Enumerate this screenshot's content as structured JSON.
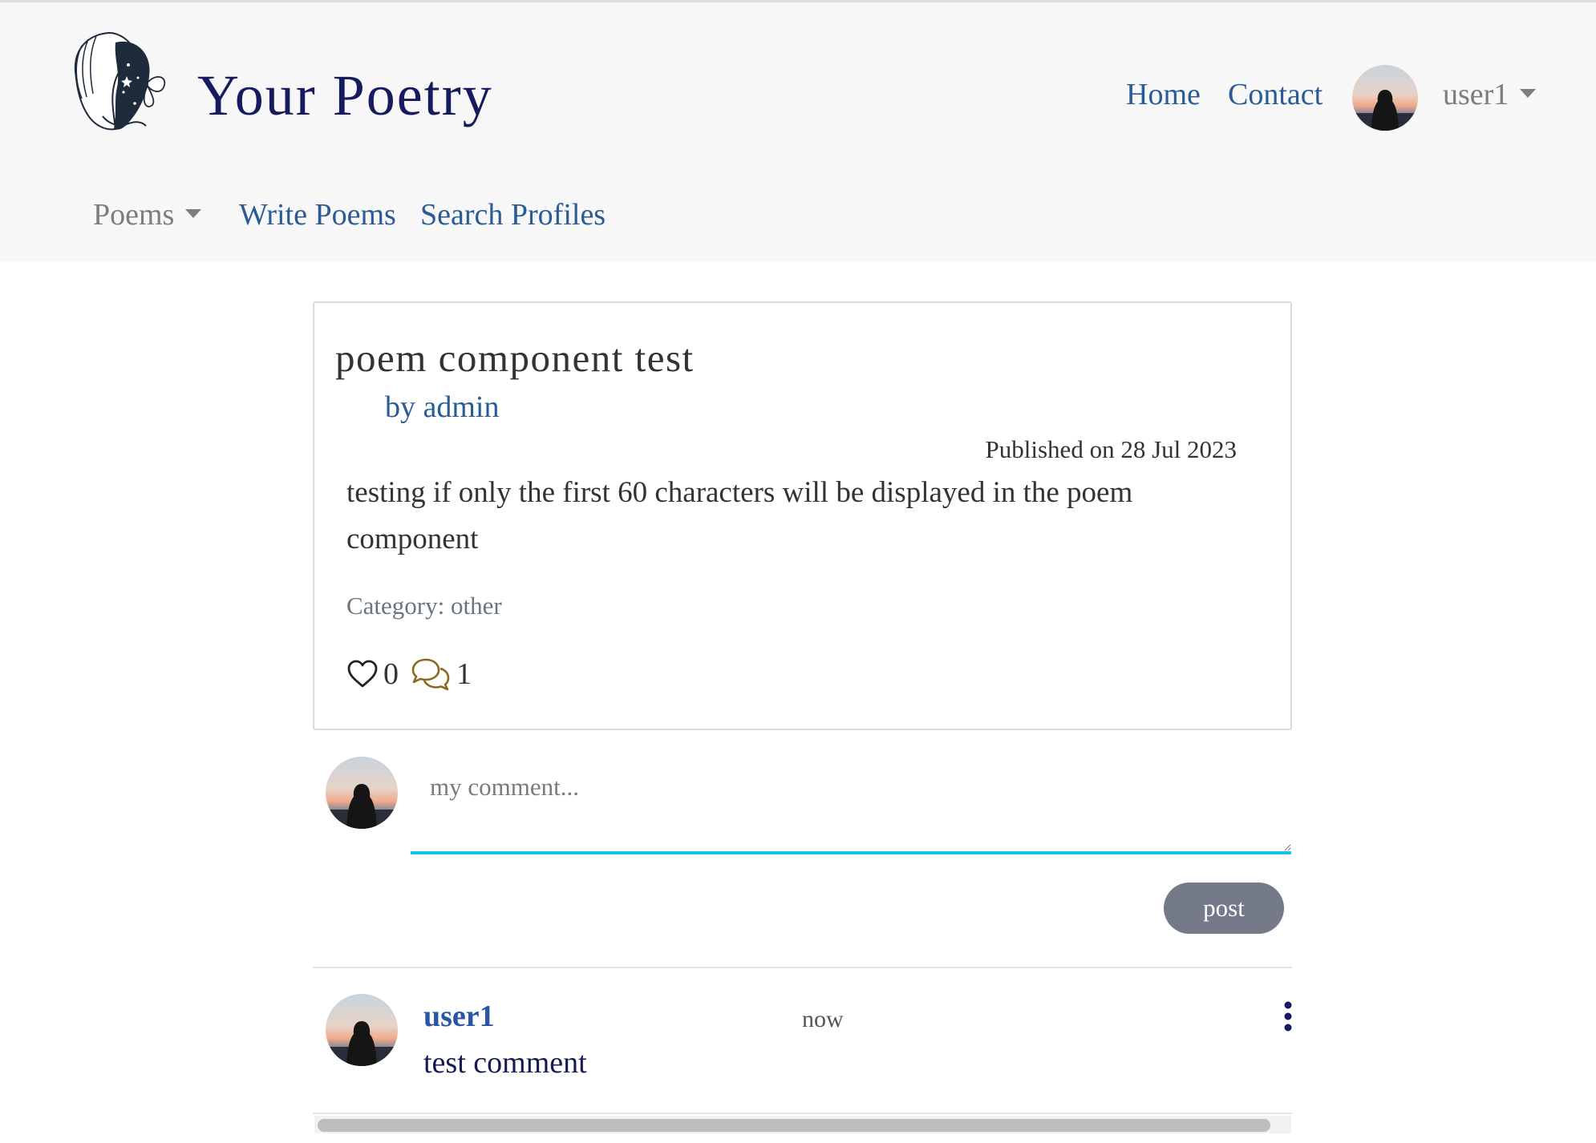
{
  "header": {
    "brand": "Your Poetry",
    "nav": {
      "home": "Home",
      "contact": "Contact"
    },
    "user_menu_label": "user1",
    "secondary_nav": {
      "poems": "Poems",
      "write_poems": "Write Poems",
      "search_profiles": "Search Profiles"
    }
  },
  "poem": {
    "title": "poem component test",
    "author": "by admin",
    "published": "Published on 28 Jul 2023",
    "body": "testing if only the first 60 characters will be displayed in the poem component",
    "category": "Category: other",
    "likes": "0",
    "comments": "1"
  },
  "comment_form": {
    "placeholder": "my comment...",
    "submit_label": "post"
  },
  "comments": [
    {
      "user": "user1",
      "time": "now",
      "text": "test comment"
    }
  ],
  "colors": {
    "brand": "#161a5e",
    "link": "#2a5b96",
    "accent_underline": "#1cc2e4",
    "button": "#747a87",
    "comment_icon": "#8b6a1f"
  },
  "icons": {
    "like": "heart-outline-icon",
    "comments": "chat-bubbles-icon",
    "options": "vertical-ellipsis-icon"
  }
}
